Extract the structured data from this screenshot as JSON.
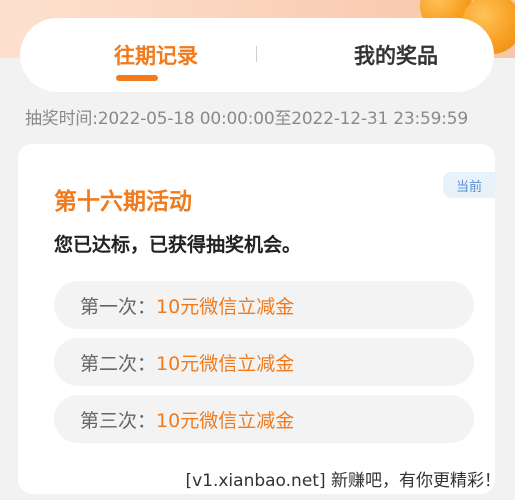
{
  "tabs": {
    "records_label": "往期记录",
    "prizes_label": "我的奖品"
  },
  "period_text": "抽奖时间:2022-05-18 00:00:00至2022-12-31 23:59:59",
  "activity": {
    "title": "第十六期活动",
    "badge": "当前",
    "subtitle": "您已达标，已获得抽奖机会。",
    "prizes": [
      {
        "label": "第一次：",
        "value": "10元微信立减金"
      },
      {
        "label": "第二次：",
        "value": "10元微信立减金"
      },
      {
        "label": "第三次：",
        "value": "10元微信立减金"
      }
    ]
  },
  "watermark": "[v1.xianbao.net] 新赚吧，有你更精彩！",
  "colors": {
    "accent": "#f07a1c",
    "badge_bg": "#e8f2fb",
    "badge_text": "#5a8fcf",
    "page_bg": "#f2f2f2"
  }
}
